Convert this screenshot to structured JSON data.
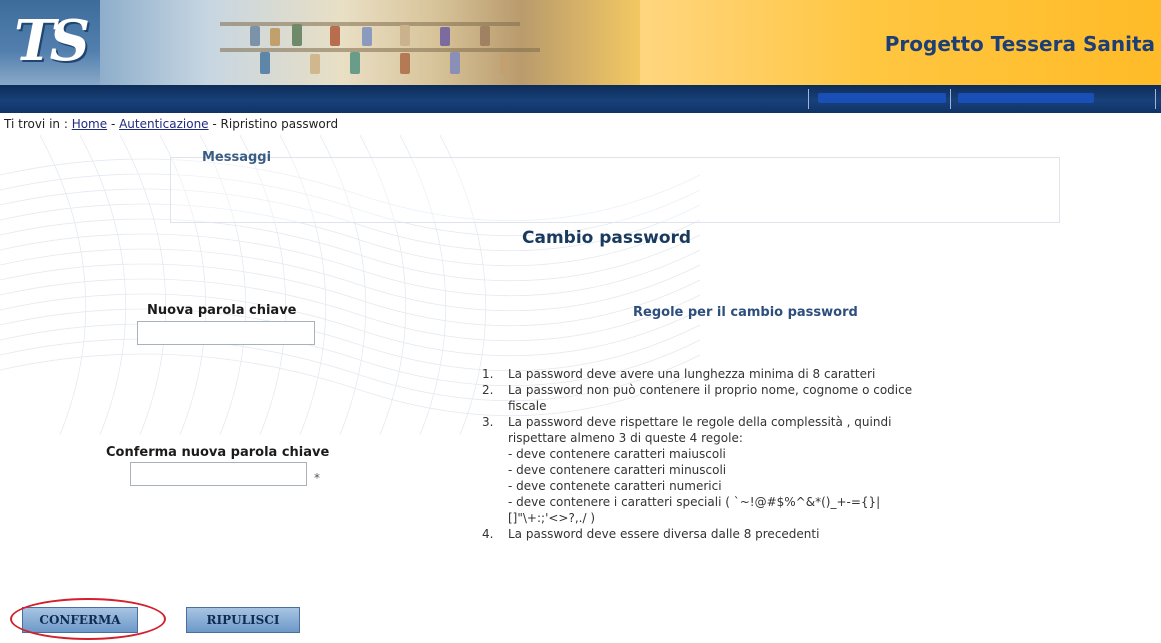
{
  "header": {
    "logo_text": "TS",
    "site_title": "Progetto Tessera Sanita"
  },
  "breadcrumb": {
    "prefix": "Ti trovi in : ",
    "items": [
      "Home",
      "Autenticazione",
      "Ripristino password"
    ],
    "separator": " - "
  },
  "messages": {
    "label": "Messaggi"
  },
  "page": {
    "title": "Cambio password"
  },
  "form": {
    "new_password_label": "Nuova parola chiave",
    "new_password_value": "",
    "confirm_password_label": "Conferma nuova parola chiave",
    "confirm_password_value": "",
    "required_mark": "*"
  },
  "rules": {
    "title": "Regole per il cambio password",
    "items": [
      {
        "num": "1.",
        "lines": [
          "La password deve avere una lunghezza minima di 8 caratteri"
        ]
      },
      {
        "num": "2.",
        "lines": [
          "La password non può contenere il proprio nome, cognome o codice",
          "fiscale"
        ]
      },
      {
        "num": "3.",
        "lines": [
          "La password deve rispettare le regole della complessità , quindi",
          "rispettare almeno 3 di queste 4 regole:",
          "- deve contenere caratteri maiuscoli",
          "- deve contenere caratteri minuscoli",
          "- deve contenete caratteri numerici",
          "- deve contenere i caratteri speciali ( `~!@#$%^&*()_+-={}|",
          "[]\"\\+:;'<>?,./ )"
        ]
      },
      {
        "num": "4.",
        "lines": [
          "La password deve essere diversa dalle 8 precedenti"
        ]
      }
    ]
  },
  "buttons": {
    "confirm": "CONFERMA",
    "clear": "RIPULISCI"
  },
  "colors": {
    "nav_bar": "#133a6e",
    "title_blue": "#1d3f76",
    "button_blue": "#7fa6d2",
    "highlight_red": "#d2202c"
  }
}
